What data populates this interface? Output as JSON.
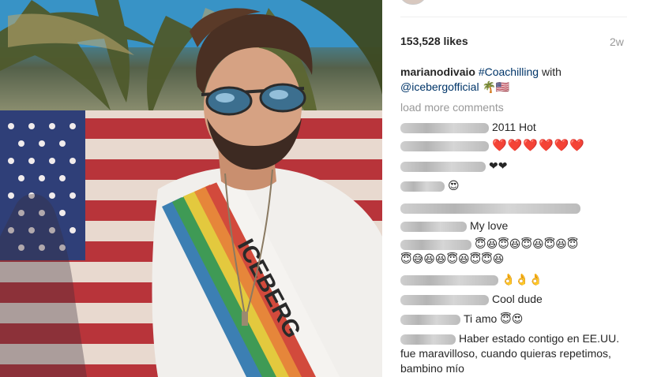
{
  "post": {
    "likes": "153,528 likes",
    "age": "2w",
    "author": "marianodivaio",
    "caption_hashtag": "#Coachilling",
    "caption_with": " with",
    "caption_mention": "@icebergofficial",
    "caption_emoji": " 🌴🇺🇸",
    "shirt_text": "ICEBERG"
  },
  "load_more": "load more comments",
  "comments": [
    {
      "text": "2011 Hot"
    },
    {
      "text": "❤️❤️❤️❤️❤️❤️"
    },
    {
      "text": "❤❤"
    },
    {
      "text": "😍"
    },
    {
      "text": ""
    },
    {
      "text": "My love"
    },
    {
      "text": "😇😆😇😆😇😆😇😆😇"
    },
    {
      "text": "😇😅😆😆😇😆😇😇😆"
    },
    {
      "text": "👌👌👌"
    },
    {
      "text": "Cool dude"
    },
    {
      "text": "Ti amo 😇😍"
    },
    {
      "text": "Haber estado contigo en EE.UU. fue maravilloso, cuando quieras repetimos, bambino mío"
    }
  ],
  "colors": {
    "link": "#003569",
    "muted": "#999999",
    "heart": "#d9262f"
  }
}
